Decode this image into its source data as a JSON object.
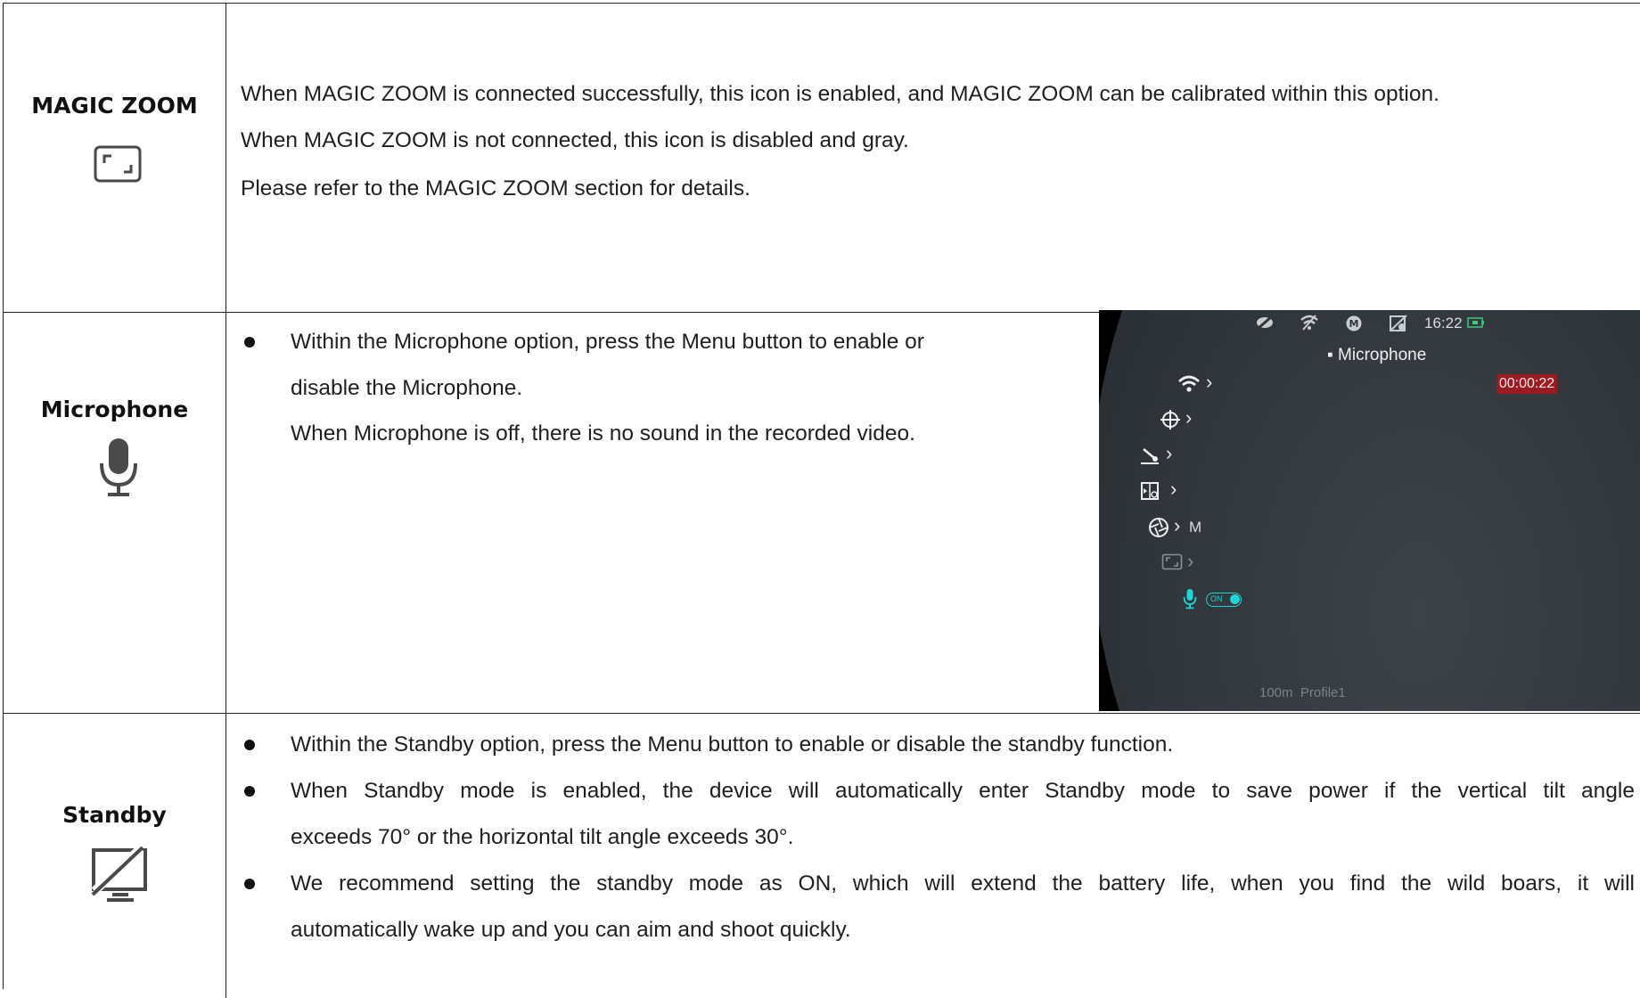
{
  "rows": [
    {
      "name": "MAGIC ZOOM",
      "icon": "magic-zoom-frame-icon",
      "paragraphs": [
        "When MAGIC ZOOM is connected successfully, this icon is enabled, and MAGIC ZOOM can be calibrated within this option.",
        "When MAGIC ZOOM is not connected, this icon is disabled and gray.",
        "Please refer to the MAGIC ZOOM section for details."
      ]
    },
    {
      "name": "Microphone",
      "icon": "microphone-icon",
      "bullet_1_line_1": "Within the Microphone option, press the Menu button to enable or",
      "bullet_1_line_2": "disable the Microphone.",
      "note": "When Microphone is off, there is no sound in the recorded video.",
      "screenshot": {
        "time": "16:22",
        "menu_title": "Microphone",
        "recording_timer": "00:00:22",
        "exposure_mode": "M",
        "toggle_label": "ON",
        "footer_distance": "100m",
        "footer_profile": "Profile1",
        "accent_color": "#1fd5d5",
        "recording_color": "#9a1b22"
      }
    },
    {
      "name": "Standby",
      "icon": "standby-tilted-screen-icon",
      "bullet_1": "Within the Standby option, press the Menu button to enable or disable the standby function.",
      "bullet_2_line_1": "When Standby mode is enabled, the device will automatically enter Standby mode to save power if the vertical tilt angle",
      "bullet_2_line_2": "exceeds 70° or the horizontal tilt angle exceeds 30°.",
      "bullet_3_line_1": "We recommend setting the standby mode as ON, which will extend the battery life, when you find the wild boars, it will",
      "bullet_3_line_2": "automatically wake up and you can aim and shoot quickly."
    }
  ]
}
